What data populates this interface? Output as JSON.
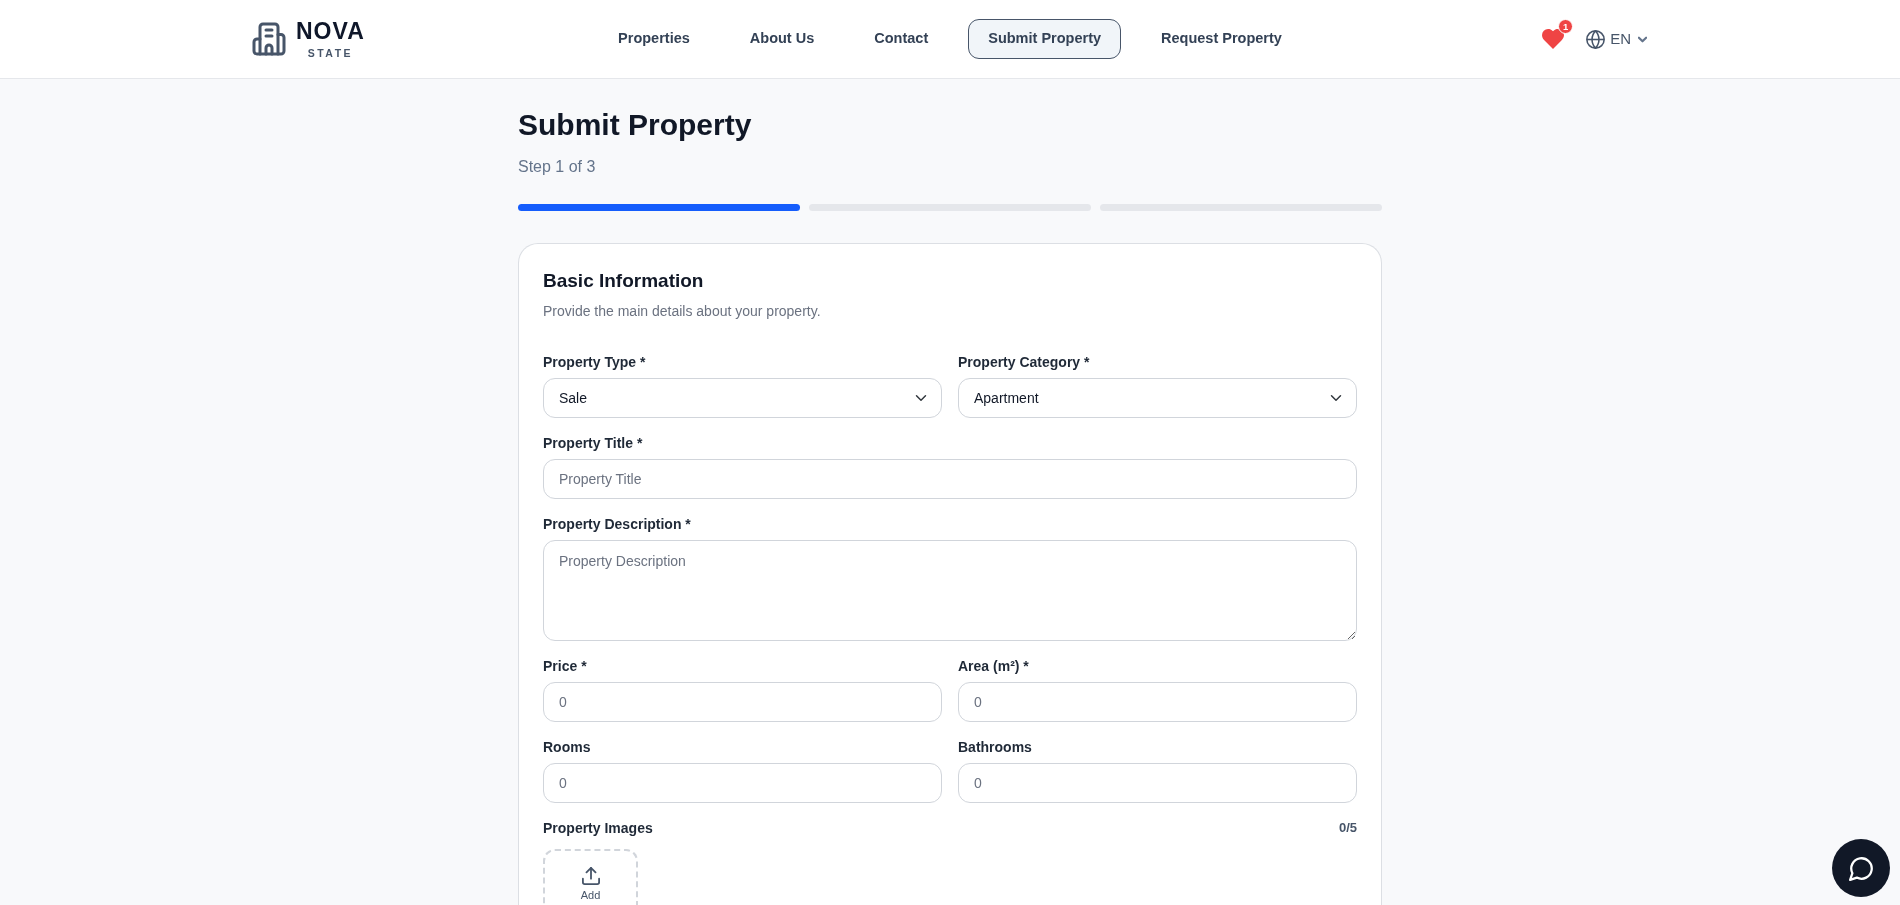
{
  "header": {
    "logo": {
      "name": "NOVA",
      "tagline": "STATE"
    },
    "nav": [
      {
        "label": "Properties",
        "selected": false
      },
      {
        "label": "About Us",
        "selected": false
      },
      {
        "label": "Contact",
        "selected": false
      },
      {
        "label": "Submit Property",
        "selected": true
      },
      {
        "label": "Request Property",
        "selected": false
      }
    ],
    "favorites": {
      "count": "1"
    },
    "language": {
      "label": "EN"
    }
  },
  "page": {
    "title": "Submit Property",
    "step": "Step 1 of 3",
    "steps": [
      {
        "active": true
      },
      {
        "active": false
      },
      {
        "active": false
      }
    ]
  },
  "section": {
    "title": "Basic Information",
    "subtitle": "Provide the main details about your property.",
    "rows": [
      [
        {
          "kind": "select",
          "label": "Property Type *",
          "value": "Sale"
        },
        {
          "kind": "select",
          "label": "Property Category *",
          "value": "Apartment"
        }
      ],
      [
        {
          "kind": "input",
          "label": "Property Title *",
          "placeholder": "Property Title"
        }
      ],
      [
        {
          "kind": "textarea",
          "label": "Property Description *",
          "placeholder": "Property Description"
        }
      ],
      [
        {
          "kind": "input",
          "label": "Price *",
          "placeholder": "0"
        },
        {
          "kind": "input",
          "label": "Area (m²) *",
          "placeholder": "0"
        }
      ],
      [
        {
          "kind": "input",
          "label": "Rooms",
          "placeholder": "0"
        },
        {
          "kind": "input",
          "label": "Bathrooms",
          "placeholder": "0"
        }
      ]
    ],
    "images": {
      "label": "Property Images",
      "count": "0/5",
      "upload_label": "Add"
    }
  }
}
